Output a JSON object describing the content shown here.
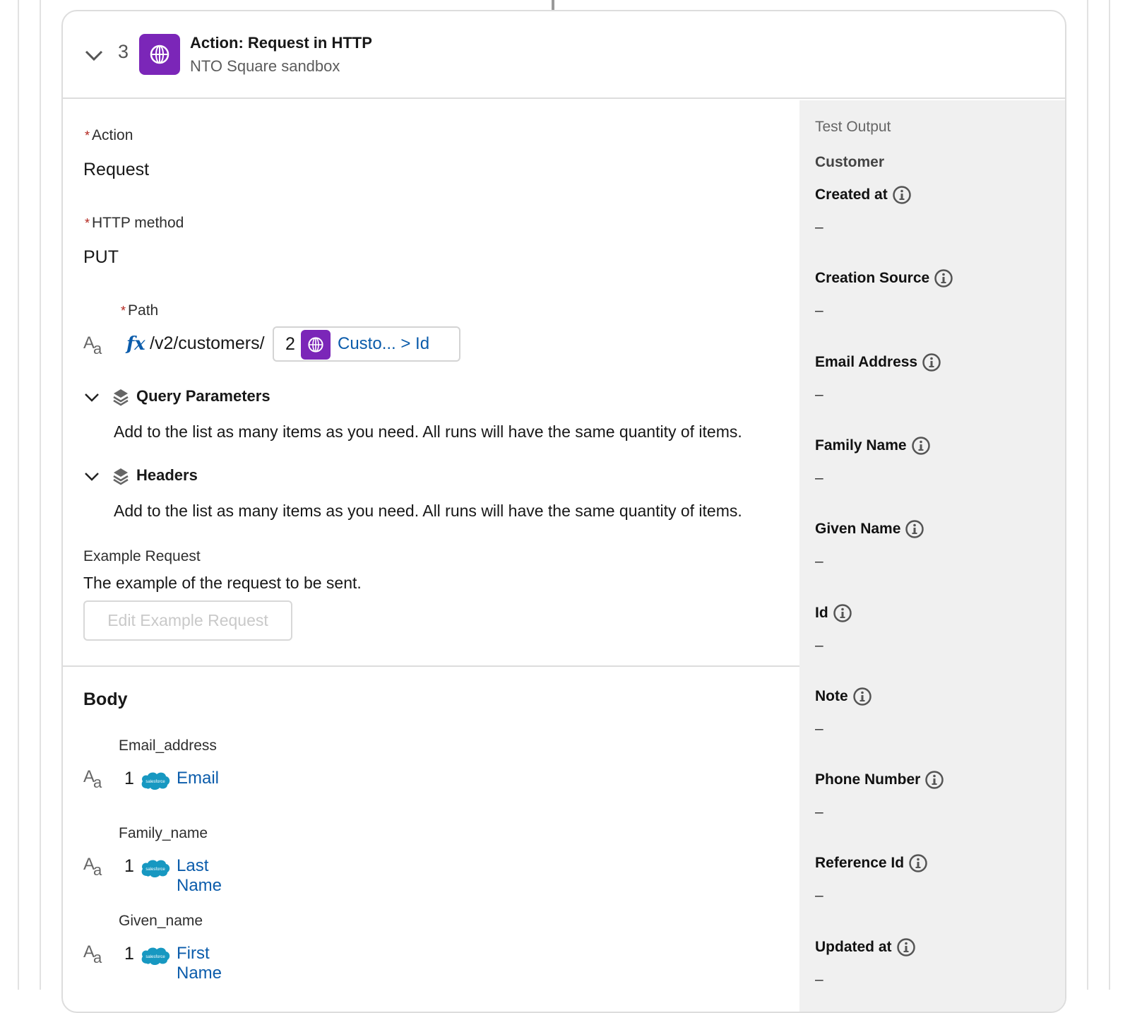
{
  "step": {
    "number": "3",
    "title": "Action: Request in HTTP",
    "subtitle": "NTO Square sandbox",
    "app_icon": "globe-icon",
    "accent_color": "#7b26b8"
  },
  "form": {
    "action": {
      "label": "Action",
      "required": "*",
      "value": "Request"
    },
    "http_method": {
      "label": "HTTP method",
      "required": "*",
      "value": "PUT"
    },
    "path": {
      "label": "Path",
      "required": "*",
      "type_icon": "text-type-icon",
      "formula_icon": "fx",
      "static_text": "/v2/customers/",
      "reference": {
        "step": "2",
        "icon": "globe-icon",
        "label": "Custo... > Id"
      }
    },
    "query_parameters": {
      "title": "Query Parameters",
      "description": "Add to the list as many items as you need. All runs will have the same quantity of items."
    },
    "headers": {
      "title": "Headers",
      "description": "Add to the list as many items as you need. All runs will have the same quantity of items."
    },
    "example_request": {
      "label": "Example Request",
      "description": "The example of the request to be sent.",
      "button_label": "Edit Example Request"
    },
    "body": {
      "title": "Body",
      "fields": [
        {
          "label": "Email_address",
          "step": "1",
          "source": "salesforce",
          "value": "Email"
        },
        {
          "label": "Family_name",
          "step": "1",
          "source": "salesforce",
          "value": "Last Name"
        },
        {
          "label": "Given_name",
          "step": "1",
          "source": "salesforce",
          "value": "First Name"
        }
      ]
    }
  },
  "test_output": {
    "heading": "Test Output",
    "group": "Customer",
    "empty_value": "–",
    "fields": [
      {
        "name": "Created at",
        "value": "–"
      },
      {
        "name": "Creation Source",
        "value": "–"
      },
      {
        "name": "Email Address",
        "value": "–"
      },
      {
        "name": "Family Name",
        "value": "–"
      },
      {
        "name": "Given Name",
        "value": "–"
      },
      {
        "name": "Id",
        "value": "–"
      },
      {
        "name": "Note",
        "value": "–"
      },
      {
        "name": "Phone Number",
        "value": "–"
      },
      {
        "name": "Reference Id",
        "value": "–"
      },
      {
        "name": "Updated at",
        "value": "–"
      }
    ]
  },
  "salesforce_logo_text": "salesforce"
}
